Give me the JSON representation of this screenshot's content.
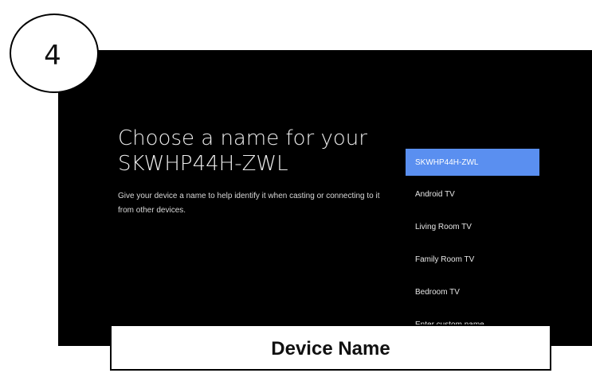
{
  "step": {
    "number": "4"
  },
  "screen": {
    "title": "Choose a name for your SKWHP44H-ZWL",
    "description": "Give your device a name to help identify it when casting or connecting to it from other devices.",
    "options": [
      {
        "label": "SKWHP44H-ZWL",
        "selected": true
      },
      {
        "label": "Android TV",
        "selected": false
      },
      {
        "label": "Living Room TV",
        "selected": false
      },
      {
        "label": "Family Room TV",
        "selected": false
      },
      {
        "label": "Bedroom TV",
        "selected": false
      },
      {
        "label": "Enter custom name...",
        "selected": false
      }
    ]
  },
  "caption": {
    "label": "Device Name"
  },
  "colors": {
    "screen_background": "#000000",
    "selected_highlight": "#5a8ff0",
    "text_primary": "#ececec"
  }
}
